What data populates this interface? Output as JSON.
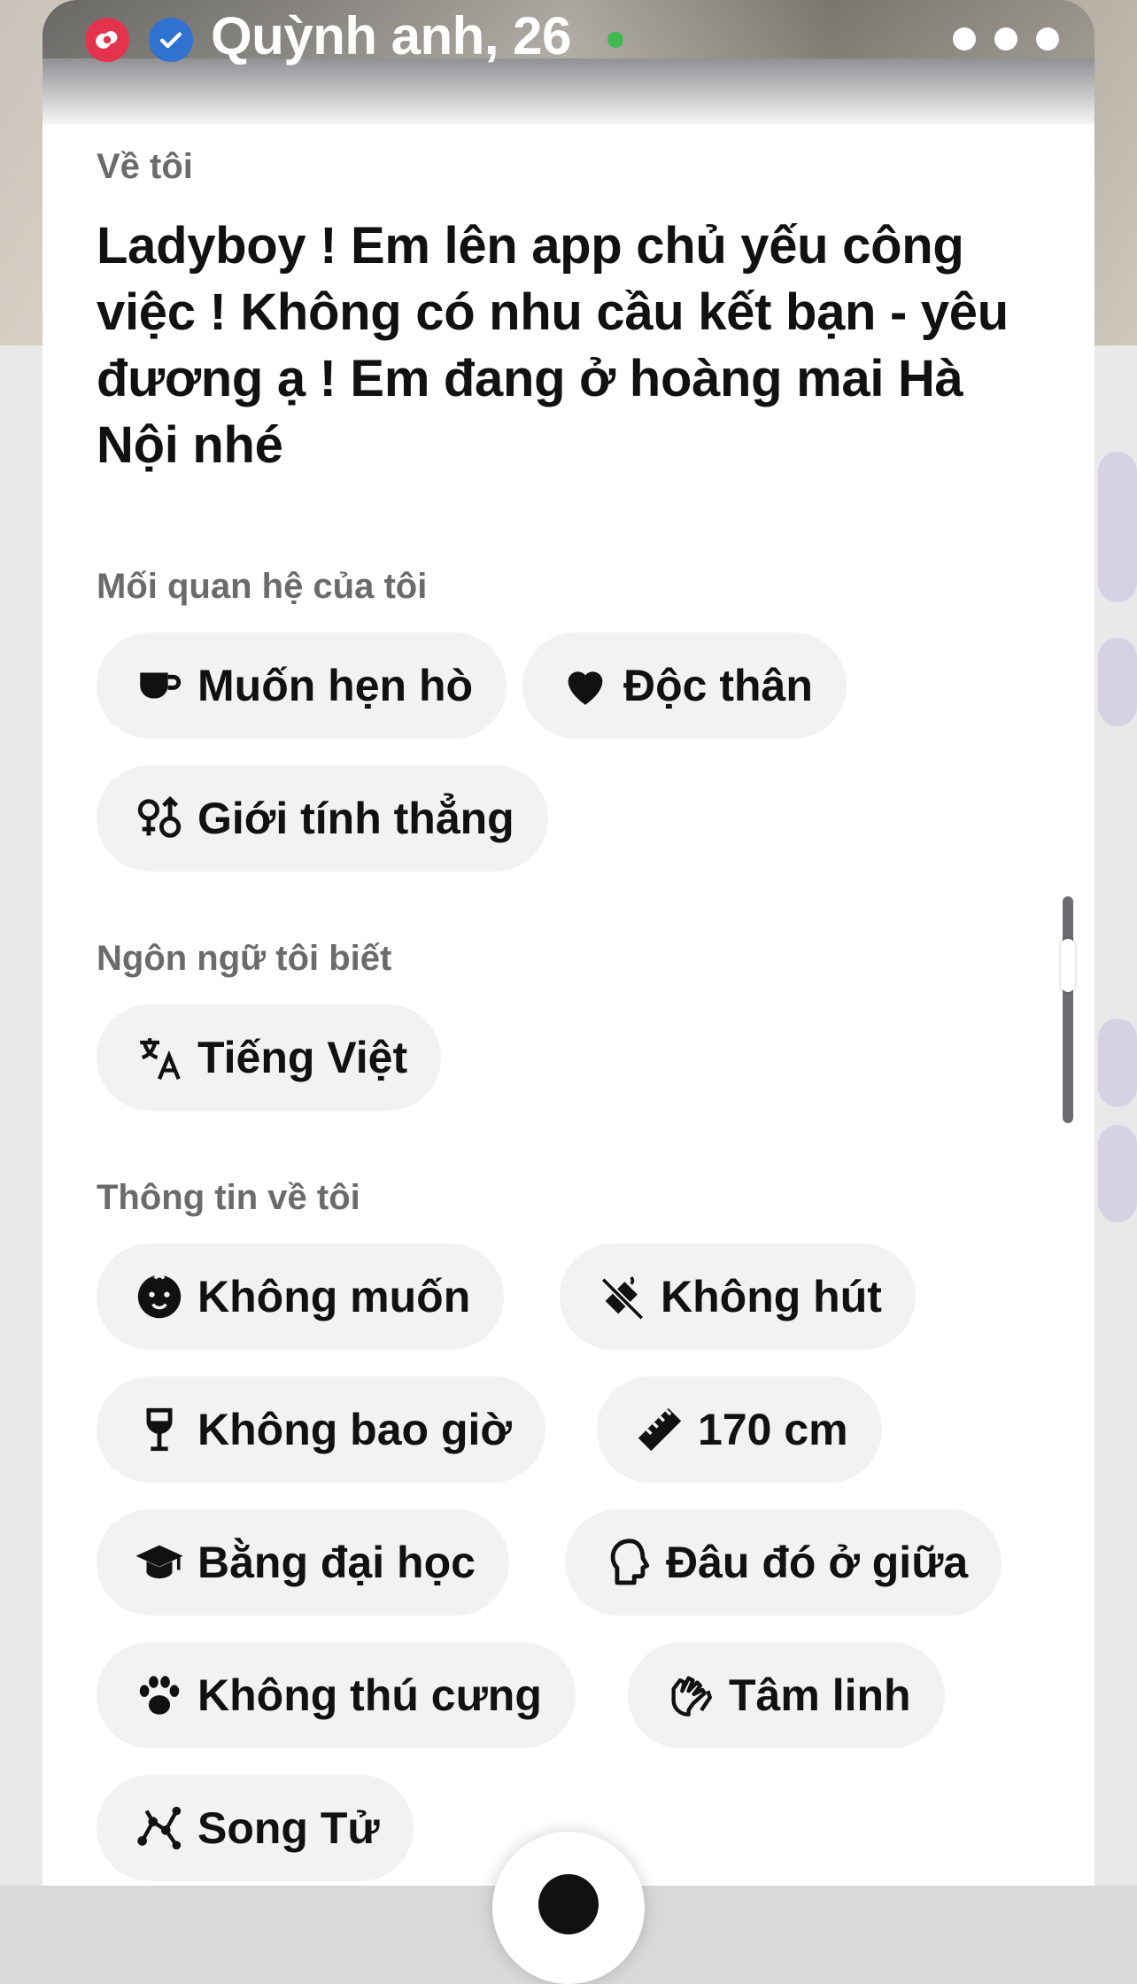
{
  "profile": {
    "name": "Quỳnh anh, 26",
    "badges": [
      "brand-badge-icon",
      "verified-icon"
    ],
    "online": true
  },
  "about": {
    "label": "Về tôi",
    "text": "Ladyboy ! Em lên app chủ yếu công việc ! Không có nhu cầu kết bạn - yêu đương ạ ! Em đang ở hoàng mai Hà Nội nhé"
  },
  "relationship": {
    "label": "Mối quan hệ của tôi",
    "chips": [
      {
        "icon": "coffee-cup-icon",
        "label": "Muốn hẹn hò"
      },
      {
        "icon": "heart-icon",
        "label": "Độc thân"
      },
      {
        "icon": "gender-icon",
        "label": "Giới tính thẳng"
      }
    ]
  },
  "languages": {
    "label": "Ngôn ngữ tôi biết",
    "chips": [
      {
        "icon": "translate-icon",
        "label": "Tiếng Việt"
      }
    ]
  },
  "info": {
    "label": "Thông tin về tôi",
    "chips": [
      {
        "icon": "baby-icon",
        "label": "Không muốn"
      },
      {
        "icon": "no-smoking-icon",
        "label": "Không hút"
      },
      {
        "icon": "wine-glass-icon",
        "label": "Không bao giờ"
      },
      {
        "icon": "ruler-icon",
        "label": "170 cm"
      },
      {
        "icon": "graduation-cap-icon",
        "label": "Bằng đại học"
      },
      {
        "icon": "head-silhouette-icon",
        "label": "Đâu đó ở giữa"
      },
      {
        "icon": "paw-icon",
        "label": "Không thú cưng"
      },
      {
        "icon": "praying-hands-icon",
        "label": "Tâm linh"
      },
      {
        "icon": "constellation-icon",
        "label": "Song Tử"
      }
    ]
  },
  "colors": {
    "chip_background": "#f2f2f3",
    "label_gray": "#6b6b6b",
    "online": "#3fb950",
    "badge_red": "#e4344d",
    "badge_blue": "#2f72d0"
  }
}
